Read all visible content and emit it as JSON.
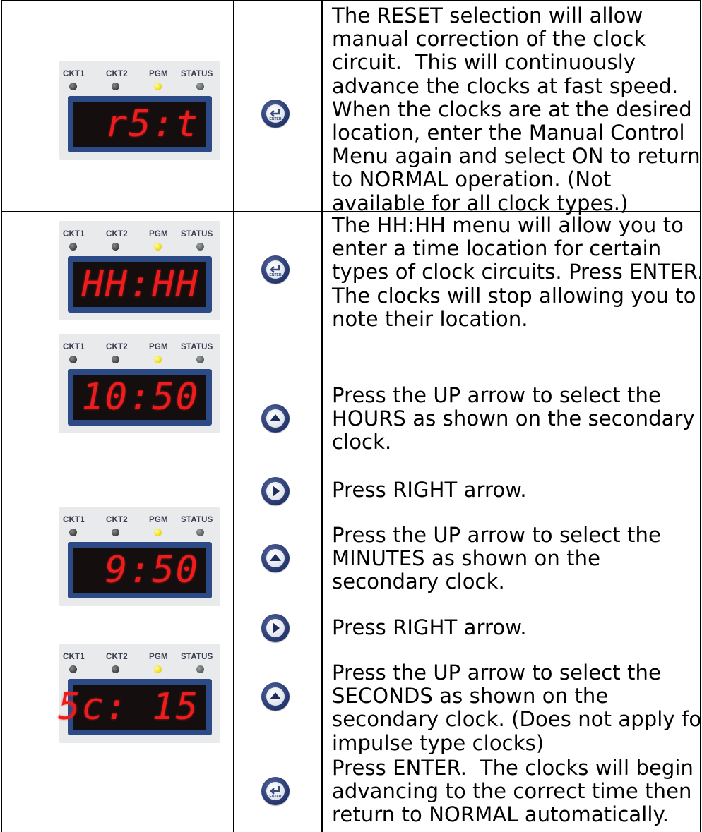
{
  "rows": [
    {
      "panel": {
        "labels": [
          "CKT1",
          "CKT2",
          "PGM",
          "STATUS"
        ],
        "display": "r5:t"
      },
      "button": "enter-button",
      "text": "The RESET selection will allow\nmanual correction of the clock\ncircuit.  This will continuously\nadvance the clocks at fast speed.\nWhen the clocks are at the desired\nlocation, enter the Manual Control\nMenu again and select ON to return\nto NORMAL operation. (Not\navailable for all clock types.)"
    },
    {
      "panel": {
        "labels": [
          "CKT1",
          "CKT2",
          "PGM",
          "STATUS"
        ],
        "display": "HH:HH"
      },
      "button": "enter-button",
      "text": "The HH:HH menu will allow you to\nenter a time location for certain\ntypes of clock circuits. Press ENTER.\nThe clocks will stop allowing you to\nnote their location."
    },
    {
      "panel": {
        "labels": [
          "CKT1",
          "CKT2",
          "PGM",
          "STATUS"
        ],
        "display": "10:50"
      },
      "button": "up-button",
      "text": "Press the UP arrow to select the\nHOURS as shown on the secondary\nclock."
    },
    {
      "button": "right-button",
      "text": "Press RIGHT arrow."
    },
    {
      "panel": {
        "labels": [
          "CKT1",
          "CKT2",
          "PGM",
          "STATUS"
        ],
        "display": "9:50"
      },
      "button": "up-button",
      "text": "Press the UP arrow to select the\nMINUTES as shown on the\nsecondary clock."
    },
    {
      "button": "right-button",
      "text": "Press RIGHT arrow."
    },
    {
      "panel": {
        "labels": [
          "CKT1",
          "CKT2",
          "PGM",
          "STATUS"
        ],
        "display": "5c: 15"
      },
      "button": "up-button",
      "text": "Press the UP arrow to select the\nSECONDS as shown on the\nsecondary clock. (Does not apply for\nimpulse type clocks)"
    },
    {
      "button": "enter-button",
      "text": "Press ENTER.  The clocks will begin\nadvancing to the correct time then\nreturn to NORMAL automatically."
    }
  ],
  "colors": {
    "led_on": "#f2e22a",
    "digit": "#ee1c1c",
    "frame": "#2c4a86",
    "button": "#23356c"
  }
}
